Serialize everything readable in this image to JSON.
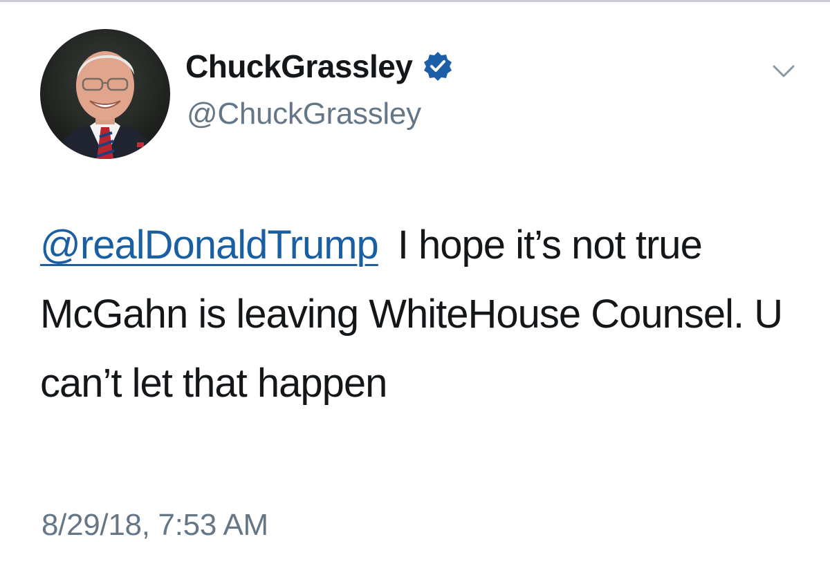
{
  "tweet": {
    "author": {
      "display_name": "ChuckGrassley",
      "handle": "@ChuckGrassley",
      "verified": true,
      "avatar_icon": "profile-photo"
    },
    "menu_icon": "chevron-down-icon",
    "body": {
      "mention": "@realDonaldTrump",
      "text": "I hope it’s not true McGahn is leaving WhiteHouse Counsel. U can’t let that happen"
    },
    "timestamp": "8/29/18, 7:53 AM"
  },
  "colors": {
    "text": "#14171a",
    "secondary": "#657786",
    "link": "#1b5fa3",
    "verified_badge": "#1d5ea8"
  }
}
